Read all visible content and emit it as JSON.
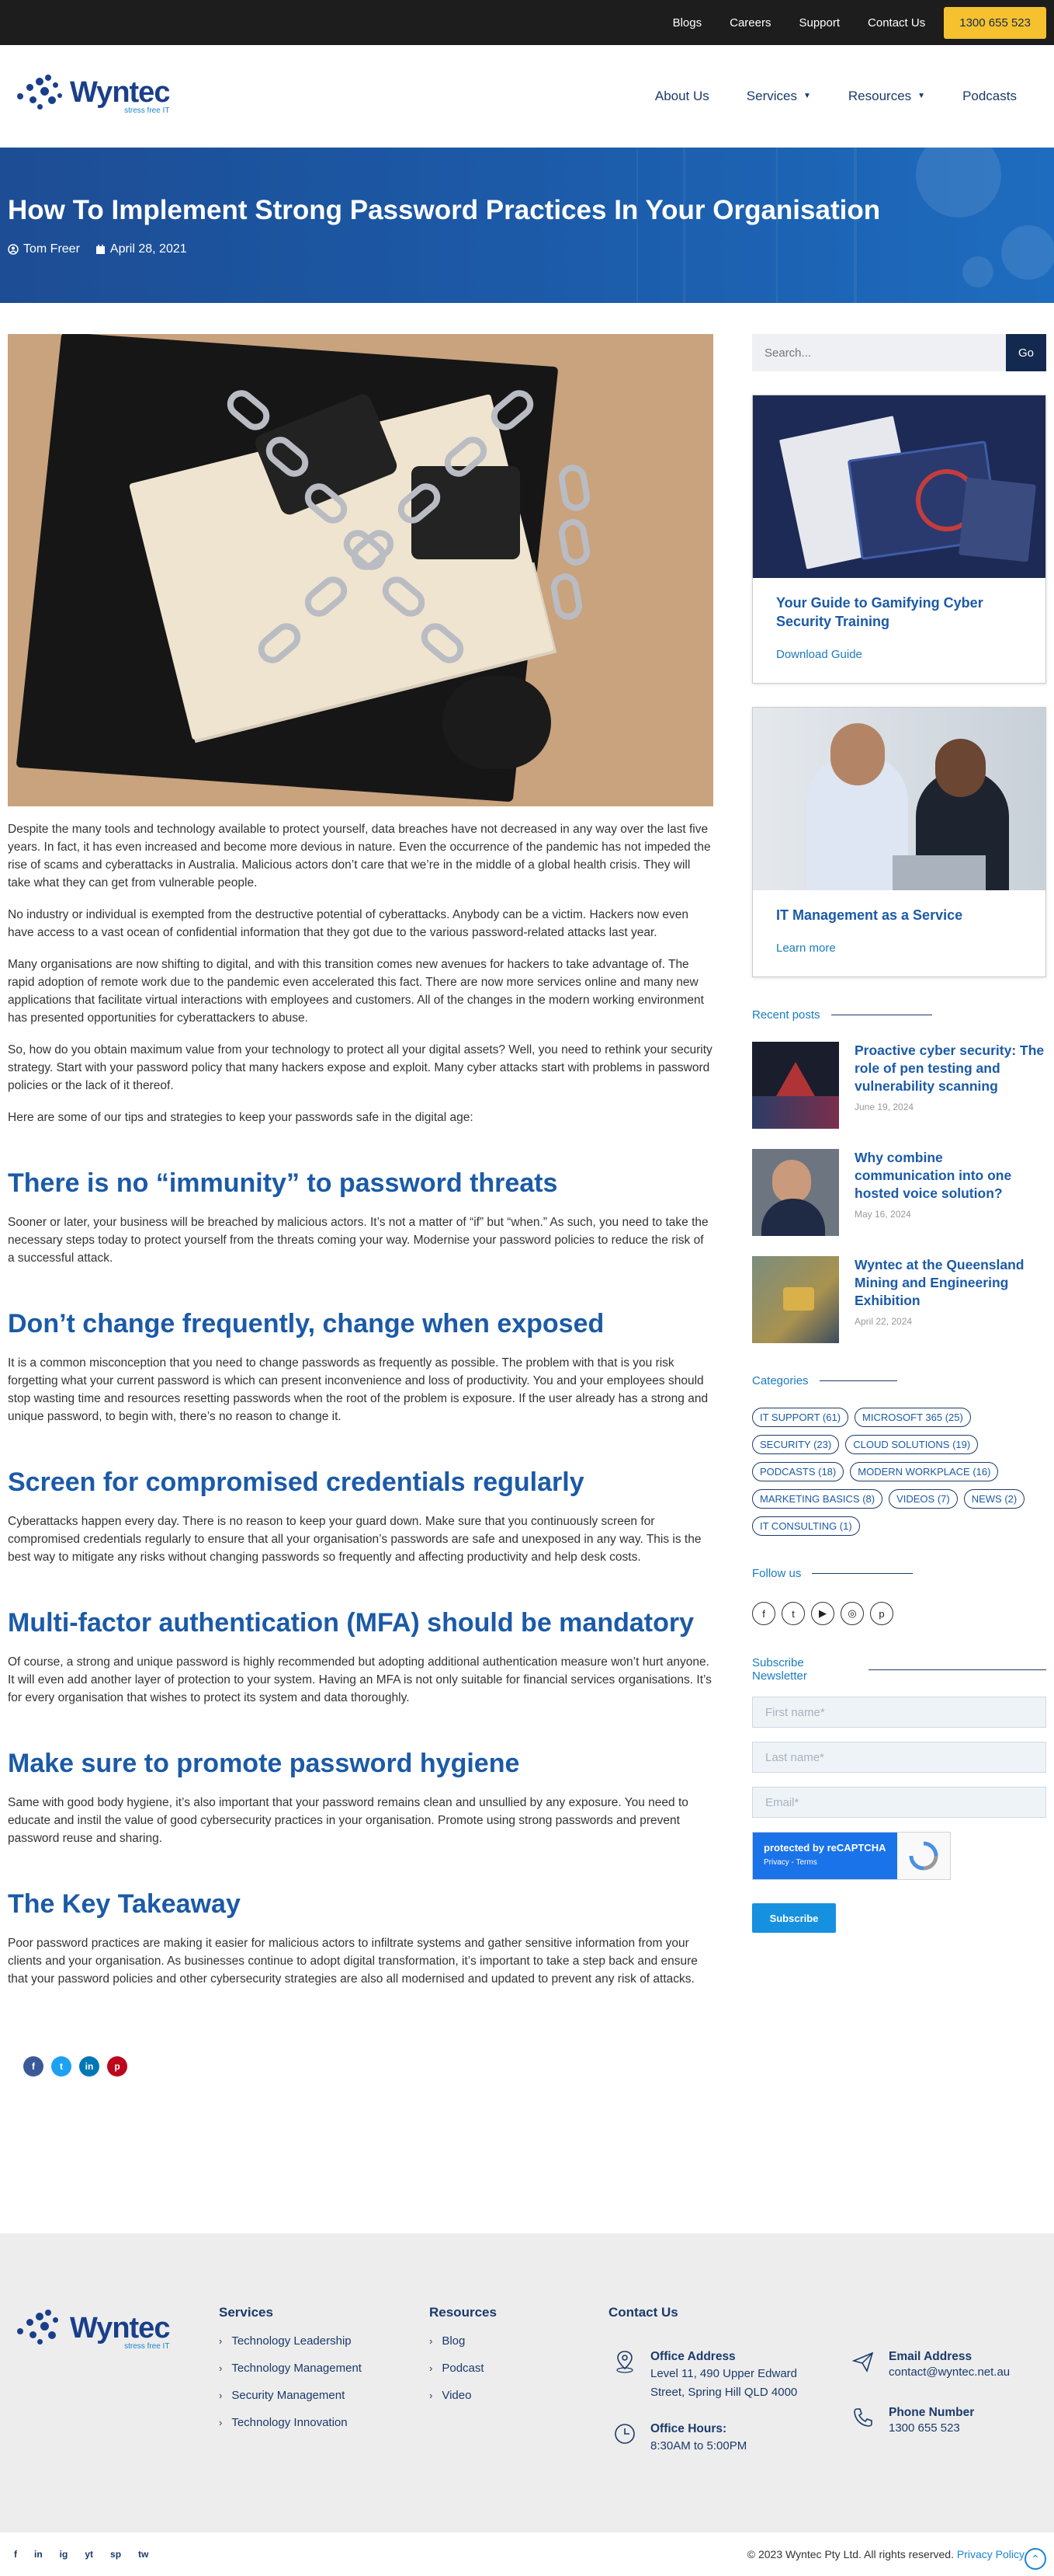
{
  "topbar": {
    "links": [
      "Blogs",
      "Careers",
      "Support",
      "Contact Us"
    ],
    "phone": "1300 655 523"
  },
  "brand": {
    "name": "Wyntec",
    "tagline": "stress free IT"
  },
  "nav": {
    "items": [
      {
        "label": "About Us",
        "dropdown": false
      },
      {
        "label": "Services",
        "dropdown": true
      },
      {
        "label": "Resources",
        "dropdown": true
      },
      {
        "label": "Podcasts",
        "dropdown": false
      }
    ]
  },
  "hero": {
    "title": "How To Implement Strong Password Practices In Your Organisation",
    "author": "Tom Freer",
    "date": "April 28, 2021"
  },
  "article": {
    "intro": [
      "Despite the many tools and technology available to protect yourself, data breaches have not decreased in any way over the last five years. In fact, it has even increased and become more devious in nature. Even the occurrence of the pandemic has not impeded the rise of scams and cyberattacks in Australia. Malicious actors don’t care that we’re in the middle of a global health crisis. They will take what they can get from vulnerable people.",
      "No industry or individual is exempted from the destructive potential of cyberattacks. Anybody can be a victim. Hackers now even have access to a vast ocean of confidential information that they got due to the various password-related attacks last year.",
      "Many organisations are now shifting to digital, and with this transition comes new avenues for hackers to take advantage of. The rapid adoption of remote work due to the pandemic even accelerated this fact. There are now more services online and many new applications that facilitate virtual interactions with employees and customers. All of the changes in the modern working environment has presented opportunities for cyberattackers to abuse.",
      "So, how do you obtain maximum value from your technology to protect all your digital assets? Well, you need to rethink your security strategy. Start with your password policy that many hackers expose and exploit. Many cyber attacks start with problems in password policies or the lack of it thereof.",
      "Here are some of our tips and strategies to keep your passwords safe in the digital age:"
    ],
    "sections": [
      {
        "heading": "There is no “immunity” to password threats",
        "body": "Sooner or later, your business will be breached by malicious actors. It’s not a matter of “if” but “when.” As such, you need to take the necessary steps today to protect yourself from the threats coming your way. Modernise your password policies to reduce the risk of a successful attack."
      },
      {
        "heading": "Don’t change frequently, change when exposed",
        "body": "It is a common misconception that you need to change passwords as frequently as possible. The problem with that is you risk forgetting what your current password is which can present inconvenience and loss of productivity. You and your employees should stop wasting time and resources resetting passwords when the root of the problem is exposure. If the user already has a strong and unique password, to begin with, there’s no reason to change it."
      },
      {
        "heading": "Screen for compromised credentials regularly",
        "body": "Cyberattacks happen every day. There is no reason to keep your guard down. Make sure that you continuously screen for compromised credentials regularly to ensure that all your organisation’s passwords are safe and unexposed in any way. This is the best way to mitigate any risks without changing passwords so frequently and affecting productivity and help desk costs."
      },
      {
        "heading": "Multi-factor authentication (MFA) should be mandatory",
        "body": "Of course, a strong and unique password is highly recommended but adopting additional authentication measure won’t hurt anyone. It will even add another layer of protection to your system. Having an MFA is not only suitable for financial services organisations. It’s for every organisation that wishes to protect its system and data thoroughly."
      },
      {
        "heading": "Make sure to promote password hygiene",
        "body": "Same with good body hygiene, it’s also important that your password remains clean and unsullied by any exposure. You need to educate and instil the value of good cybersecurity practices in your organisation. Promote using strong passwords and prevent password reuse and sharing."
      },
      {
        "heading": "The Key Takeaway",
        "body": "Poor password practices are making it easier for malicious actors to infiltrate systems and gather sensitive information from your clients and your organisation. As businesses continue to adopt digital transformation, it’s important to take a step back and ensure that your password policies and other cybersecurity strategies are also all modernised and updated to prevent any risk of attacks."
      }
    ],
    "share": [
      {
        "icon": "facebook-icon",
        "color": "#3b5998",
        "glyph": "f"
      },
      {
        "icon": "twitter-icon",
        "color": "#1da1f2",
        "glyph": "t"
      },
      {
        "icon": "linkedin-icon",
        "color": "#0077b5",
        "glyph": "in"
      },
      {
        "icon": "pinterest-icon",
        "color": "#bd081c",
        "glyph": "p"
      }
    ]
  },
  "sidebar": {
    "search": {
      "placeholder": "Search...",
      "button": "Go"
    },
    "promo1": {
      "title": "Your Guide to Gamifying Cyber Security Training",
      "link": "Download Guide"
    },
    "promo2": {
      "title": "IT Management as a Service",
      "link": "Learn more"
    },
    "recent_label": "Recent posts",
    "recent": [
      {
        "title": "Proactive cyber security: The role of pen testing and vulnerability scanning",
        "date": "June 19, 2024"
      },
      {
        "title": "Why combine communication into one hosted voice solution?",
        "date": "May 16, 2024"
      },
      {
        "title": "Wyntec at the Queensland Mining and Engineering Exhibition",
        "date": "April 22, 2024"
      }
    ],
    "categories_label": "Categories",
    "categories": [
      "IT SUPPORT (61)",
      "MICROSOFT 365 (25)",
      "SECURITY (23)",
      "CLOUD SOLUTIONS (19)",
      "PODCASTS (18)",
      "MODERN WORKPLACE (16)",
      "MARKETING BASICS (8)",
      "VIDEOS (7)",
      "NEWS (2)",
      "IT CONSULTING (1)"
    ],
    "follow_label": "Follow us",
    "follow": [
      "facebook-icon",
      "twitter-icon",
      "youtube-icon",
      "instagram-icon",
      "pinterest-icon"
    ],
    "newsletter_label": "Subscribe Newsletter",
    "newsletter": {
      "first": "First name*",
      "last": "Last name*",
      "email": "Email*",
      "captcha": "protected by reCAPTCHA",
      "captcha_sub": "Privacy - Terms",
      "button": "Subscribe"
    }
  },
  "footer": {
    "services_title": "Services",
    "services": [
      "Technology Leadership",
      "Technology Management",
      "Security Management",
      "Technology Innovation"
    ],
    "resources_title": "Resources",
    "resources": [
      "Blog",
      "Podcast",
      "Video"
    ],
    "contact_title": "Contact Us",
    "office_title": "Office Address",
    "office_lines": [
      "Level 11, 490 Upper Edward",
      "Street, Spring Hill QLD 4000"
    ],
    "hours_title": "Office Hours:",
    "hours": "8:30AM to 5:00PM",
    "email_title": "Email Address",
    "email": "contact@wyntec.net.au",
    "phone_title": "Phone Number",
    "phone": "1300 655 523"
  },
  "bottom": {
    "social": [
      "f",
      "in",
      "ig",
      "yt",
      "sp",
      "tw"
    ],
    "copyright": "© 2023 Wyntec Pty Ltd. All rights reserved.",
    "privacy": "Privacy Policy"
  }
}
